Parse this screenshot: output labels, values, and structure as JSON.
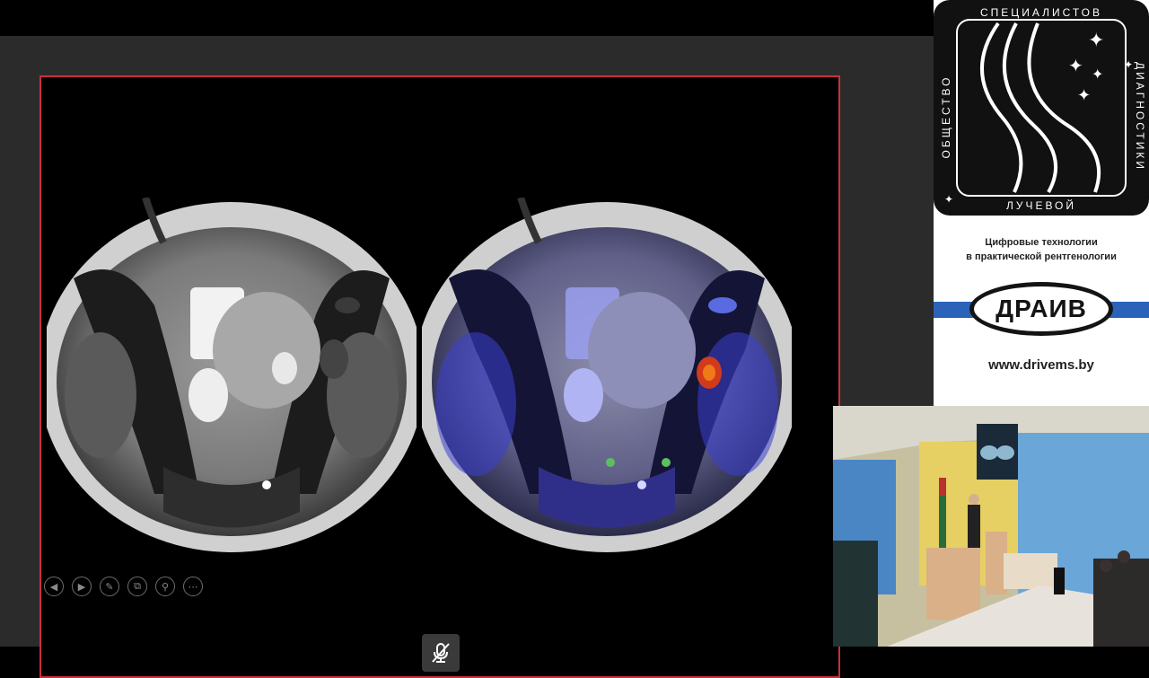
{
  "sponsor": {
    "emblem_text_top": "СПЕЦИАЛИСТОВ",
    "emblem_text_left": "ОБЩЕСТВО",
    "emblem_text_right": "ДИАГНОСТИКИ",
    "emblem_text_bottom": "ЛУЧЕВОЙ",
    "tagline_line1": "Цифровые технологии",
    "tagline_line2": "в практической рентгенологии",
    "logo_text": "ДРАИВ",
    "website": "www.drivems.by"
  },
  "presentation": {
    "controls": [
      {
        "icon": "previous-slide-icon",
        "glyph": "◀"
      },
      {
        "icon": "next-slide-icon",
        "glyph": "▶"
      },
      {
        "icon": "pen-icon",
        "glyph": "✎"
      },
      {
        "icon": "slides-overview-icon",
        "glyph": "⧉"
      },
      {
        "icon": "zoom-icon",
        "glyph": "⚲"
      },
      {
        "icon": "more-options-icon",
        "glyph": "⋯"
      }
    ],
    "mic_icon": "microphone-muted-icon"
  },
  "colors": {
    "frame_border": "#c8303a",
    "logo_band": "#2a63b8",
    "overlay_blue": "#3a3fd0"
  }
}
